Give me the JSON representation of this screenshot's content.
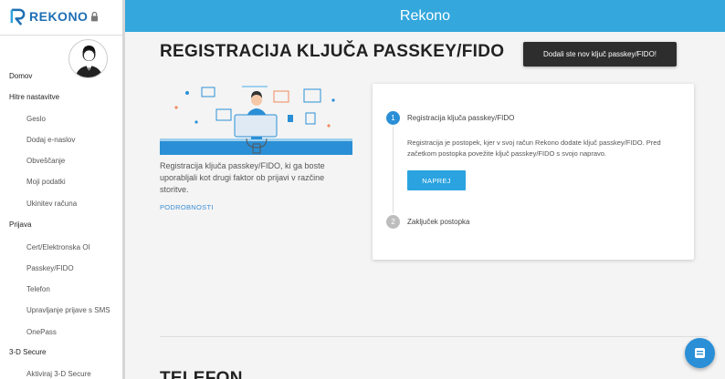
{
  "logo": {
    "text": "REKONO"
  },
  "header": {
    "title": "Rekono"
  },
  "sidebar": {
    "items": [
      {
        "label": "Domov",
        "type": "section"
      },
      {
        "label": "Hitre nastavitve",
        "type": "section"
      },
      {
        "label": "Geslo",
        "type": "sub"
      },
      {
        "label": "Dodaj e-naslov",
        "type": "sub"
      },
      {
        "label": "Obveščanje",
        "type": "sub"
      },
      {
        "label": "Moji podatki",
        "type": "sub"
      },
      {
        "label": "Ukinitev računa",
        "type": "sub"
      },
      {
        "label": "Prijava",
        "type": "section"
      },
      {
        "label": "Cert/Elektronska OI",
        "type": "sub"
      },
      {
        "label": "Passkey/FIDO",
        "type": "sub"
      },
      {
        "label": "Telefon",
        "type": "sub"
      },
      {
        "label": "Upravljanje prijave s SMS",
        "type": "sub"
      },
      {
        "label": "OnePass",
        "type": "sub"
      },
      {
        "label": "3-D Secure",
        "type": "section"
      },
      {
        "label": "Aktiviraj 3-D Secure",
        "type": "sub"
      }
    ]
  },
  "main": {
    "title": "REGISTRACIJA KLJUČA PASSKEY/FIDO",
    "add_button": "Dodali ste nov ključ passkey/FIDO!",
    "description": "Registracija ključa passkey/FIDO, ki ga boste uporabljali kot drugi faktor ob prijavi v razčine storitve.",
    "more_link": "PODROBNOSTI",
    "section2_title": "TELEFON"
  },
  "wizard": {
    "step1": {
      "number": "1",
      "label": "Registracija ključa passkey/FIDO",
      "text": "Registracija je postopek, kjer v svoj račun Rekono dodate ključ passkey/FIDO. Pred začetkom postopka povežite ključ passkey/FIDO s svojo napravo.",
      "button": "NAPREJ"
    },
    "step2": {
      "number": "2",
      "label": "Zaključek postopka"
    }
  },
  "colors": {
    "header": "#34a7dd",
    "accent": "#2a8fd6",
    "dark_button": "#2d2d2d"
  },
  "icons": {
    "logo": "rekono-logo-icon",
    "lock": "lock-icon",
    "avatar": "user-avatar-icon",
    "fab": "chat-icon"
  }
}
